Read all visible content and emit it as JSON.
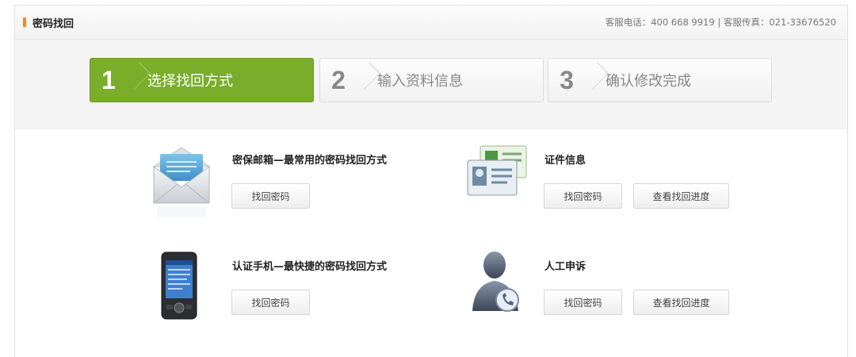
{
  "header": {
    "title": "密码找回",
    "contact": "客服电话：400 668 9919 | 客服传真：021-33676520"
  },
  "steps": [
    {
      "number": "1",
      "label": "选择找回方式",
      "active": true
    },
    {
      "number": "2",
      "label": "输入资料信息",
      "active": false
    },
    {
      "number": "3",
      "label": "确认修改完成",
      "active": false
    }
  ],
  "options": {
    "email": {
      "title": "密保邮箱—最常用的密码找回方式",
      "button": "找回密码",
      "icon": "email-envelope-icon"
    },
    "id_card": {
      "title": "证件信息",
      "button": "找回密码",
      "progress_button": "查看找回进度",
      "icon": "id-card-icon"
    },
    "phone": {
      "title": "认证手机—最快捷的密码找回方式",
      "button": "找回密码",
      "icon": "mobile-phone-icon"
    },
    "manual": {
      "title": "人工申诉",
      "button": "找回密码",
      "progress_button": "查看找回进度",
      "icon": "customer-service-icon"
    }
  },
  "colors": {
    "accent_green": "#7aad2a",
    "title_marker": "#f08a24"
  }
}
